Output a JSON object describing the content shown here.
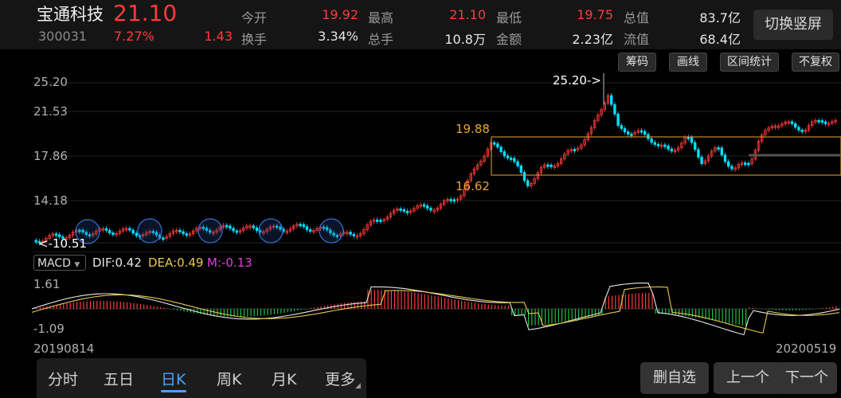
{
  "stock": {
    "name": "宝通科技",
    "price": "21.10",
    "code": "300031",
    "change_pct": "7.27%",
    "change": "1.43"
  },
  "quote": {
    "open_label": "今开",
    "open": "19.92",
    "high_label": "最高",
    "high": "21.10",
    "low_label": "最低",
    "low": "19.75",
    "total_value_label": "总值",
    "total_value": "83.7亿",
    "turnover_label": "换手",
    "turnover": "3.34%",
    "volume_label": "总手",
    "volume": "10.8万",
    "amount_label": "金额",
    "amount": "2.23亿",
    "float_value_label": "流值",
    "float_value": "68.4亿"
  },
  "toggle_label": "切换竖屏",
  "toolbar": [
    "筹码",
    "画线",
    "区间统计",
    "不复权"
  ],
  "kline": {
    "y_labels": [
      "25.20",
      "21.53",
      "17.86",
      "14.18",
      "10.51"
    ],
    "max_marker": "25.20->",
    "range_high": "19.88",
    "range_low": "16.62",
    "min_marker": "<-10.51",
    "up_color": "#ff3b3b",
    "down_color": "#00e0ff",
    "range_color": "#e8a33a"
  },
  "macd": {
    "selector": "MACD",
    "dif": "DIF:0.42",
    "dea": "DEA:0.49",
    "m": "M:-0.13",
    "y_top": "1.61",
    "y_bottom": "-1.09"
  },
  "dates": {
    "start": "20190814",
    "end": "20200519"
  },
  "tabs": [
    "分时",
    "五日",
    "日K",
    "周K",
    "月K",
    "更多"
  ],
  "active_tab": "日K",
  "bottom_buttons": [
    "删自选",
    "上一个",
    "下一个"
  ]
}
